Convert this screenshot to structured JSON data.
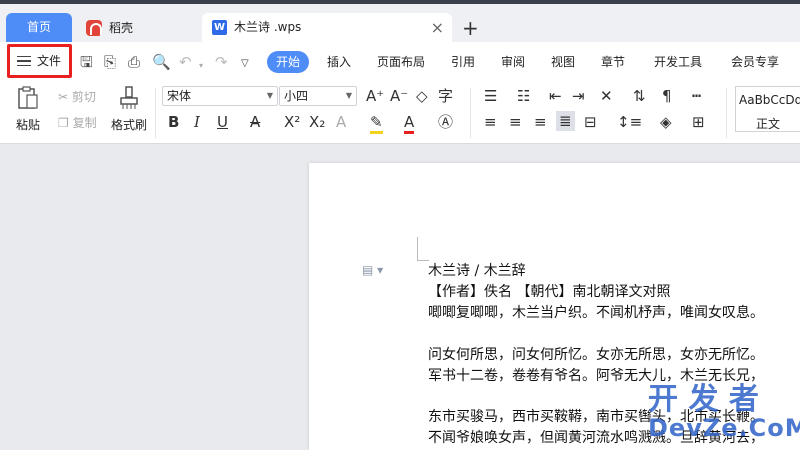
{
  "tabs": {
    "home": "首页",
    "daoke": "稻壳",
    "doc": "木兰诗 .wps",
    "close": "×",
    "add": "+"
  },
  "menu": {
    "file": "文件",
    "items": [
      "开始",
      "插入",
      "页面布局",
      "引用",
      "审阅",
      "视图",
      "章节",
      "开发工具",
      "会员专享"
    ]
  },
  "toolbar": {
    "paste": "粘贴",
    "cut": "剪切",
    "copy": "复制",
    "format_painter": "格式刷",
    "font": "宋体",
    "size": "小四",
    "style_preview": "AaBbCcDd",
    "style_name": "正文"
  },
  "document": {
    "lines": [
      "木兰诗 / 木兰辞",
      "【作者】佚名 【朝代】南北朝译文对照",
      "唧唧复唧唧，木兰当户织。不闻机杼声，唯闻女叹息。",
      "",
      "问女何所思，问女何所忆。女亦无所思，女亦无所忆。",
      "军书十二卷，卷卷有爷名。阿爷无大儿，木兰无长兄，",
      "",
      "东市买骏马，西市买鞍鞯，南市买辔头，北市买长鞭。",
      "不闻爷娘唤女声，但闻黄河流水鸣溅溅。旦辞黄河去，"
    ]
  },
  "watermark": {
    "cn": "开 发 者",
    "en": "DevZe.CoM"
  },
  "colors": {
    "accent": "#4e8cf7",
    "highlight_box": "#e82020"
  }
}
